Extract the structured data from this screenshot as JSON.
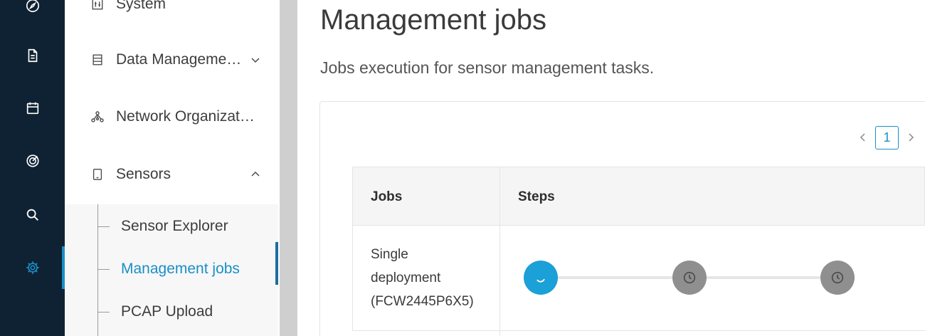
{
  "sidebar": {
    "rail_icons": [
      "compass-icon",
      "document-icon",
      "calendar-icon",
      "target-icon",
      "search-icon",
      "gear-icon"
    ],
    "items": [
      {
        "label": "System",
        "icon": "system-icon"
      },
      {
        "label": "Data Manageme…",
        "icon": "database-icon",
        "chevron": "down"
      },
      {
        "label": "Network Organizat…",
        "icon": "network-icon"
      },
      {
        "label": "Sensors",
        "icon": "sensor-icon",
        "chevron": "up"
      }
    ],
    "sensors_children": [
      {
        "label": "Sensor Explorer"
      },
      {
        "label": "Management jobs",
        "active": true
      },
      {
        "label": "PCAP Upload"
      }
    ]
  },
  "page": {
    "title": "Management jobs",
    "subtitle": "Jobs execution for sensor management tasks."
  },
  "pagination": {
    "current_page": "1"
  },
  "table": {
    "headers": [
      "Jobs",
      "Steps"
    ],
    "rows": [
      {
        "job_lines": [
          "Single",
          "deployment",
          "(FCW2445P6X5)"
        ],
        "steps": [
          "running",
          "pending",
          "pending"
        ]
      }
    ]
  },
  "colors": {
    "rail_bg": "#0f2233",
    "accent": "#1a8fc7",
    "step_running": "#1ba0d7",
    "step_pending": "#8f8f8f"
  }
}
